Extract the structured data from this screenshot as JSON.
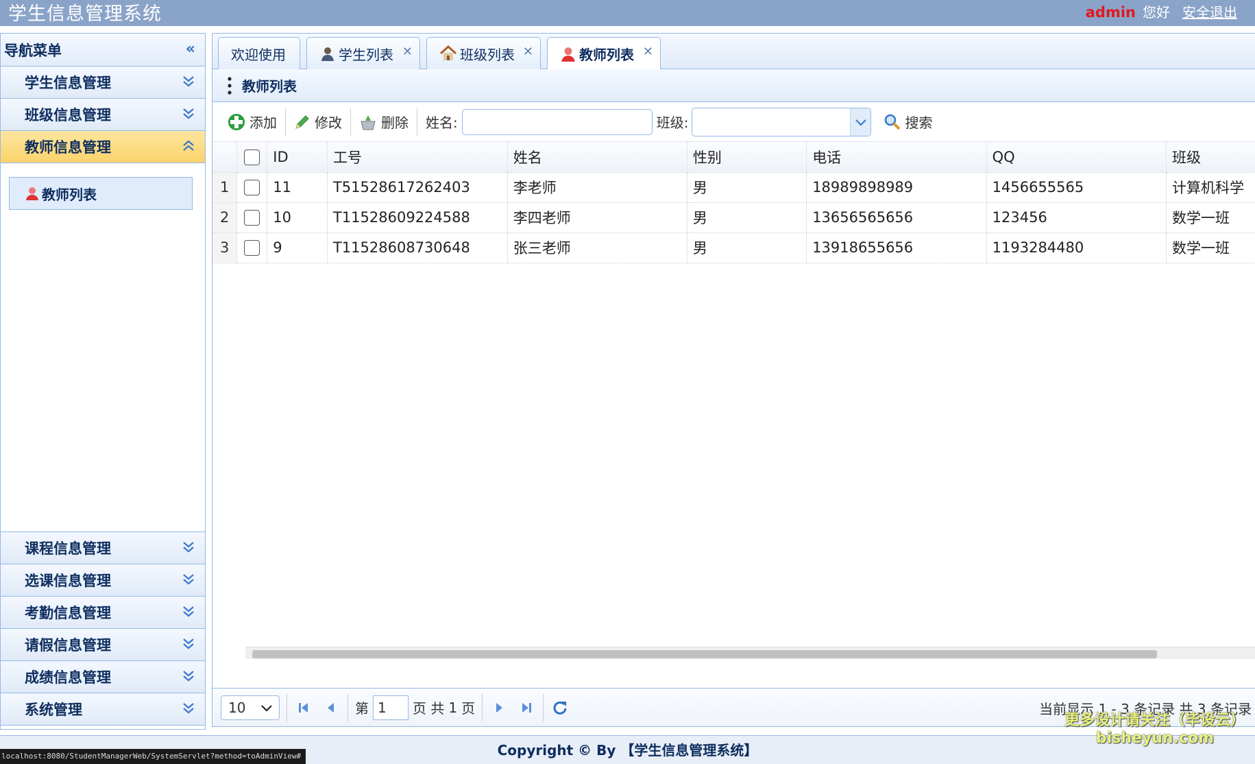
{
  "header": {
    "title": "学生信息管理系统",
    "user": "admin",
    "greeting": "您好",
    "logout": "安全退出"
  },
  "sidebar": {
    "title": "导航菜单",
    "menus": [
      {
        "label": "学生信息管理"
      },
      {
        "label": "班级信息管理"
      },
      {
        "label": "教师信息管理"
      },
      {
        "label": "课程信息管理"
      },
      {
        "label": "选课信息管理"
      },
      {
        "label": "考勤信息管理"
      },
      {
        "label": "请假信息管理"
      },
      {
        "label": "成绩信息管理"
      },
      {
        "label": "系统管理"
      }
    ],
    "submenu": {
      "label": "教师列表",
      "icon": "teacher-icon"
    }
  },
  "tabs": [
    {
      "label": "欢迎使用"
    },
    {
      "label": "学生列表",
      "icon": "student-icon"
    },
    {
      "label": "班级列表",
      "icon": "home-icon"
    },
    {
      "label": "教师列表",
      "icon": "teacher-icon"
    }
  ],
  "panel": {
    "title": "教师列表"
  },
  "toolbar": {
    "add": "添加",
    "edit": "修改",
    "delete": "删除",
    "name_label": "姓名:",
    "class_label": "班级:",
    "search": "搜索",
    "name_value": "",
    "class_value": ""
  },
  "grid": {
    "columns": [
      "ID",
      "工号",
      "姓名",
      "性别",
      "电话",
      "QQ",
      "班级"
    ],
    "rows": [
      {
        "rn": "1",
        "id": "11",
        "no": "T51528617262403",
        "name": "李老师",
        "sex": "男",
        "phone": "18989898989",
        "qq": "1456655565",
        "cls": "计算机科学"
      },
      {
        "rn": "2",
        "id": "10",
        "no": "T11528609224588",
        "name": "李四老师",
        "sex": "男",
        "phone": "13656565656",
        "qq": "123456",
        "cls": "数学一班"
      },
      {
        "rn": "3",
        "id": "9",
        "no": "T11528608730648",
        "name": "张三老师",
        "sex": "男",
        "phone": "13918655656",
        "qq": "1193284480",
        "cls": "数学一班"
      }
    ]
  },
  "pager": {
    "page_size": "10",
    "before": "第",
    "page": "1",
    "after": "页 共",
    "total_pages": "1",
    "unit": "页",
    "info": "当前显示 1 - 3 条记录 共 3 条记录"
  },
  "footer": {
    "copyright": "Copyright © By 【学生信息管理系统】"
  },
  "status": {
    "url": "localhost:8080/StudentManagerWeb/SystemServlet?method=toAdminView#"
  },
  "watermark": {
    "line1": "更多设计请关注（毕设云）",
    "line2": "bisheyun.com"
  },
  "colors": {
    "header": "#8aa3c8",
    "border": "#95b8e7",
    "active_menu": "#fbd36a",
    "accent_red": "#e0191f"
  }
}
